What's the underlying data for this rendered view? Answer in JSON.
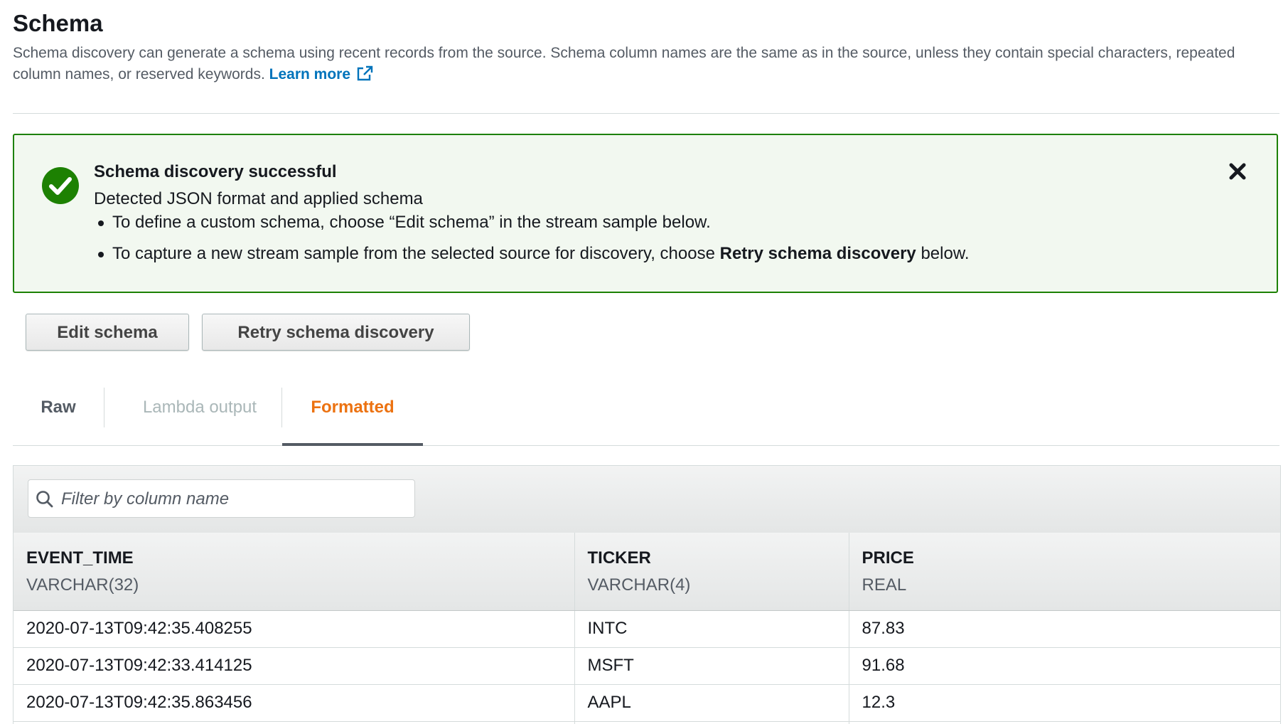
{
  "header": {
    "title": "Schema",
    "description": "Schema discovery can generate a schema using recent records from the source. Schema column names are the same as in the source, unless they contain special characters, repeated column names, or reserved keywords.",
    "learn_more": "Learn more"
  },
  "flash": {
    "title": "Schema discovery successful",
    "subtitle": "Detected JSON format and applied schema",
    "item1": "To define a custom schema, choose “Edit schema” in the stream sample below.",
    "item2_prefix": "To capture a new stream sample from the selected source for discovery, choose ",
    "item2_bold": "Retry schema discovery",
    "item2_suffix": " below.",
    "status_color": "#1d8102"
  },
  "buttons": {
    "edit": "Edit schema",
    "retry": "Retry schema discovery"
  },
  "tabs": [
    {
      "label": "Raw",
      "state": "normal"
    },
    {
      "label": "Lambda output",
      "state": "disabled"
    },
    {
      "label": "Formatted",
      "state": "active"
    }
  ],
  "filter": {
    "placeholder": "Filter by column name"
  },
  "table": {
    "columns": [
      {
        "name": "EVENT_TIME",
        "type": "VARCHAR(32)"
      },
      {
        "name": "TICKER",
        "type": "VARCHAR(4)"
      },
      {
        "name": "PRICE",
        "type": "REAL"
      }
    ],
    "rows": [
      [
        "2020-07-13T09:42:35.408255",
        "INTC",
        "87.83"
      ],
      [
        "2020-07-13T09:42:33.414125",
        "MSFT",
        "91.68"
      ],
      [
        "2020-07-13T09:42:35.863456",
        "AAPL",
        "12.3"
      ],
      [
        "",
        "",
        ""
      ]
    ]
  },
  "icons": {
    "success": "check-circle-icon",
    "close": "close-icon",
    "external": "external-link-icon",
    "search": "search-icon"
  },
  "colors": {
    "link": "#0073bb",
    "active_tab": "#ec7211",
    "success": "#1d8102"
  }
}
